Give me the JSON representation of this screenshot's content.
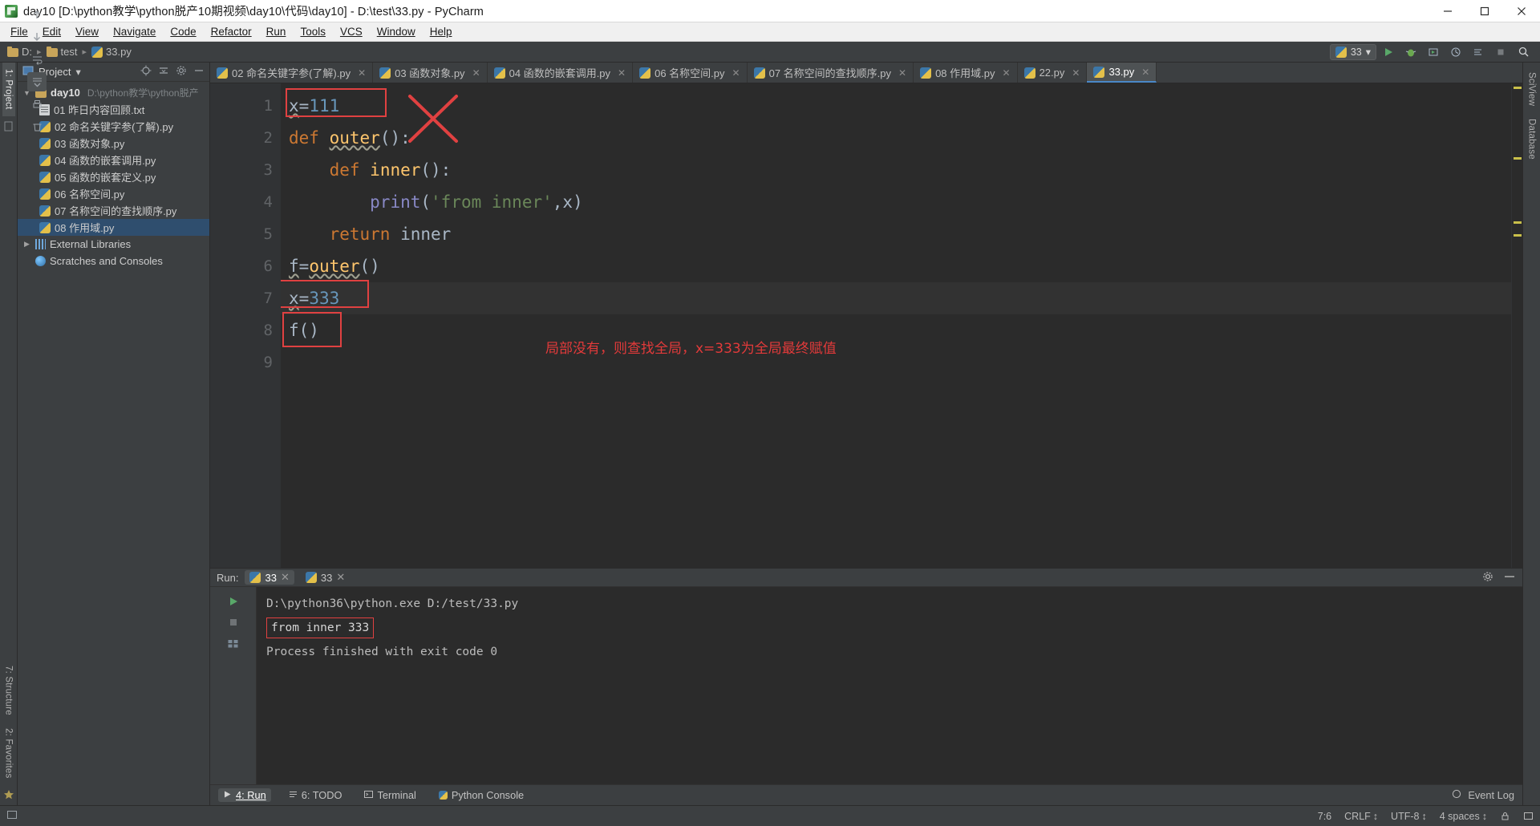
{
  "window": {
    "title": "day10 [D:\\python教学\\python脱产10期视频\\day10\\代码\\day10] - D:\\test\\33.py - PyCharm",
    "minimize": "—",
    "maximize": "☐",
    "close": "✕"
  },
  "menubar": [
    {
      "label": "File"
    },
    {
      "label": "Edit"
    },
    {
      "label": "View"
    },
    {
      "label": "Navigate"
    },
    {
      "label": "Code"
    },
    {
      "label": "Refactor"
    },
    {
      "label": "Run"
    },
    {
      "label": "Tools"
    },
    {
      "label": "VCS"
    },
    {
      "label": "Window"
    },
    {
      "label": "Help"
    }
  ],
  "navbar": {
    "crumbs": [
      "D:",
      "test",
      "33.py"
    ],
    "run_config": "33",
    "run_config_caret": "▾"
  },
  "left_strip": {
    "project_tab": "1: Project",
    "structure_tab": "7: Structure",
    "favorites_tab": "2: Favorites"
  },
  "right_strip": {
    "sciview_tab": "SciView",
    "database_tab": "Database"
  },
  "project": {
    "header": "Project",
    "header_caret": "▾",
    "tree": [
      {
        "label": "day10",
        "path": "D:\\python教学\\python脱产",
        "icon": "folder-icon",
        "depth": 0,
        "expanded": true,
        "bold": true,
        "selected": false
      },
      {
        "label": "01 昨日内容回顾.txt",
        "path": "",
        "icon": "text-file-icon",
        "depth": 1,
        "expanded": null,
        "bold": false,
        "selected": false
      },
      {
        "label": "02 命名关键字参(了解).py",
        "path": "",
        "icon": "python-file-icon",
        "depth": 1,
        "expanded": null,
        "bold": false,
        "selected": false
      },
      {
        "label": "03 函数对象.py",
        "path": "",
        "icon": "python-file-icon",
        "depth": 1,
        "expanded": null,
        "bold": false,
        "selected": false
      },
      {
        "label": "04 函数的嵌套调用.py",
        "path": "",
        "icon": "python-file-icon",
        "depth": 1,
        "expanded": null,
        "bold": false,
        "selected": false
      },
      {
        "label": "05 函数的嵌套定义.py",
        "path": "",
        "icon": "python-file-icon",
        "depth": 1,
        "expanded": null,
        "bold": false,
        "selected": false
      },
      {
        "label": "06 名称空间.py",
        "path": "",
        "icon": "python-file-icon",
        "depth": 1,
        "expanded": null,
        "bold": false,
        "selected": false
      },
      {
        "label": "07 名称空间的查找顺序.py",
        "path": "",
        "icon": "python-file-icon",
        "depth": 1,
        "expanded": null,
        "bold": false,
        "selected": false
      },
      {
        "label": "08 作用域.py",
        "path": "",
        "icon": "python-file-icon",
        "depth": 1,
        "expanded": null,
        "bold": false,
        "selected": true
      },
      {
        "label": "External Libraries",
        "path": "",
        "icon": "library-icon",
        "depth": 0,
        "expanded": false,
        "bold": false,
        "selected": false
      },
      {
        "label": "Scratches and Consoles",
        "path": "",
        "icon": "scratch-icon",
        "depth": 0,
        "expanded": null,
        "bold": false,
        "selected": false
      }
    ]
  },
  "editor_tabs": [
    {
      "label": "02 命名关键字参(了解).py",
      "active": false
    },
    {
      "label": "03 函数对象.py",
      "active": false
    },
    {
      "label": "04 函数的嵌套调用.py",
      "active": false
    },
    {
      "label": "06 名称空间.py",
      "active": false
    },
    {
      "label": "07 名称空间的查找顺序.py",
      "active": false
    },
    {
      "label": "08 作用域.py",
      "active": false
    },
    {
      "label": "22.py",
      "active": false
    },
    {
      "label": "33.py",
      "active": true
    }
  ],
  "editor": {
    "line_numbers": [
      "1",
      "2",
      "3",
      "4",
      "5",
      "6",
      "7",
      "8",
      "9"
    ],
    "lines": [
      {
        "n": 1,
        "text": "x=111"
      },
      {
        "n": 2,
        "text": "def outer():"
      },
      {
        "n": 3,
        "text": "    def inner():"
      },
      {
        "n": 4,
        "text": "        print('from inner',x)"
      },
      {
        "n": 5,
        "text": "    return inner"
      },
      {
        "n": 6,
        "text": "f=outer()"
      },
      {
        "n": 7,
        "text": "x=333"
      },
      {
        "n": 8,
        "text": "f()"
      },
      {
        "n": 9,
        "text": ""
      }
    ],
    "annotation": "局部没有，则查找全局，x=333为全局最终赋值",
    "annotation_color": "#e23a3a"
  },
  "run_panel": {
    "label": "Run:",
    "tabs": [
      {
        "label": "33",
        "active": true
      },
      {
        "label": "33",
        "active": false
      }
    ],
    "console_lines": [
      {
        "text": "D:\\python36\\python.exe D:/test/33.py",
        "boxed": false
      },
      {
        "text": "from inner 333",
        "boxed": true
      },
      {
        "text": "",
        "boxed": false
      },
      {
        "text": "Process finished with exit code 0",
        "boxed": false
      }
    ]
  },
  "bottom_bar": {
    "items": [
      {
        "label": "4: Run",
        "active": true,
        "icon": "run-icon"
      },
      {
        "label": "6: TODO",
        "active": false,
        "icon": "todo-icon"
      },
      {
        "label": "Terminal",
        "active": false,
        "icon": "terminal-icon"
      },
      {
        "label": "Python Console",
        "active": false,
        "icon": "python-console-icon"
      }
    ],
    "event_log": "Event Log"
  },
  "statusbar": {
    "caret": "7:6",
    "line_sep": "CRLF",
    "encoding": "UTF-8",
    "indent": "4 spaces"
  },
  "colors": {
    "accent": "#4a88c7",
    "annotation_red": "#e04141",
    "selection_blue": "#2f4e6e",
    "editor_bg": "#2b2b2b",
    "panel_bg": "#3c3f41"
  }
}
